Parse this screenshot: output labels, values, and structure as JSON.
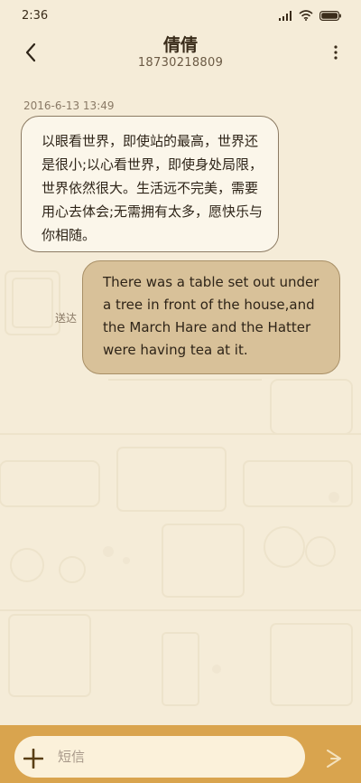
{
  "status_bar": {
    "time": "2:36"
  },
  "contact": {
    "name": "倩倩",
    "number": "18730218809"
  },
  "messages": [
    {
      "direction": "incoming",
      "timestamp": "2016-6-13 13:49",
      "text": "以眼看世界，即使站的最高，世界还是很小;以心看世界，即使身处局限，世界依然很大。生活远不完美，需要用心去体会;无需拥有太多，愿快乐与你相随。"
    },
    {
      "direction": "outgoing",
      "status": "送达",
      "text": "There was a table set out under a tree in front of the house,and the March Hare and the Hatter were having tea at it."
    }
  ],
  "composer": {
    "placeholder": "短信"
  },
  "icons": {
    "signal": "signal-icon",
    "wifi": "wifi-icon",
    "battery": "battery-icon",
    "back": "back-arrow-icon",
    "more": "more-vertical-icon",
    "add": "plus-icon",
    "send": "send-arrow-icon"
  },
  "colors": {
    "background": "#f5ecd8",
    "incoming_bubble": "#fbf6ea",
    "outgoing_bubble": "#d8c199",
    "composer_bar": "#d9a44e",
    "composer_input": "#fbf1da"
  }
}
